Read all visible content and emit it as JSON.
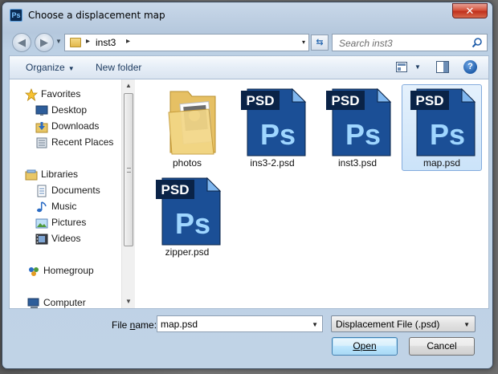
{
  "window": {
    "title": "Choose a displacement map",
    "close_glyph": "✕",
    "app_icon_text": "Ps"
  },
  "address": {
    "crumbs": [
      "inst3"
    ],
    "separator": "▸",
    "dropdown_glyph": "▾"
  },
  "search": {
    "placeholder": "Search inst3"
  },
  "commandbar": {
    "organize_label": "Organize",
    "new_folder_label": "New folder",
    "help_glyph": "?"
  },
  "nav_pane": {
    "favorites": {
      "label": "Favorites",
      "items": [
        {
          "label": "Desktop",
          "icon": "desktop-icon"
        },
        {
          "label": "Downloads",
          "icon": "downloads-icon"
        },
        {
          "label": "Recent Places",
          "icon": "recent-places-icon"
        }
      ]
    },
    "libraries": {
      "label": "Libraries",
      "items": [
        {
          "label": "Documents",
          "icon": "documents-icon"
        },
        {
          "label": "Music",
          "icon": "music-icon"
        },
        {
          "label": "Pictures",
          "icon": "pictures-icon"
        },
        {
          "label": "Videos",
          "icon": "videos-icon"
        }
      ]
    },
    "homegroup": {
      "label": "Homegroup"
    },
    "computer": {
      "label": "Computer"
    }
  },
  "files": [
    {
      "name": "photos",
      "type": "folder",
      "selected": false
    },
    {
      "name": "ins3-2.psd",
      "type": "psd",
      "selected": false
    },
    {
      "name": "inst3.psd",
      "type": "psd",
      "selected": false
    },
    {
      "name": "map.psd",
      "type": "psd",
      "selected": true
    },
    {
      "name": "zipper.psd",
      "type": "psd",
      "selected": false
    }
  ],
  "psd_icon": {
    "badge": "PSD",
    "mark": "Ps",
    "colors": {
      "dark": "#0a2347",
      "mid": "#1b4f96",
      "light": "#2c6ec0"
    }
  },
  "bottom": {
    "filename_label": "File name:",
    "filename_underline_char": "n",
    "filename_value": "map.psd",
    "filetype_value": "Displacement File (.psd)",
    "open_label": "Open",
    "cancel_label": "Cancel"
  }
}
